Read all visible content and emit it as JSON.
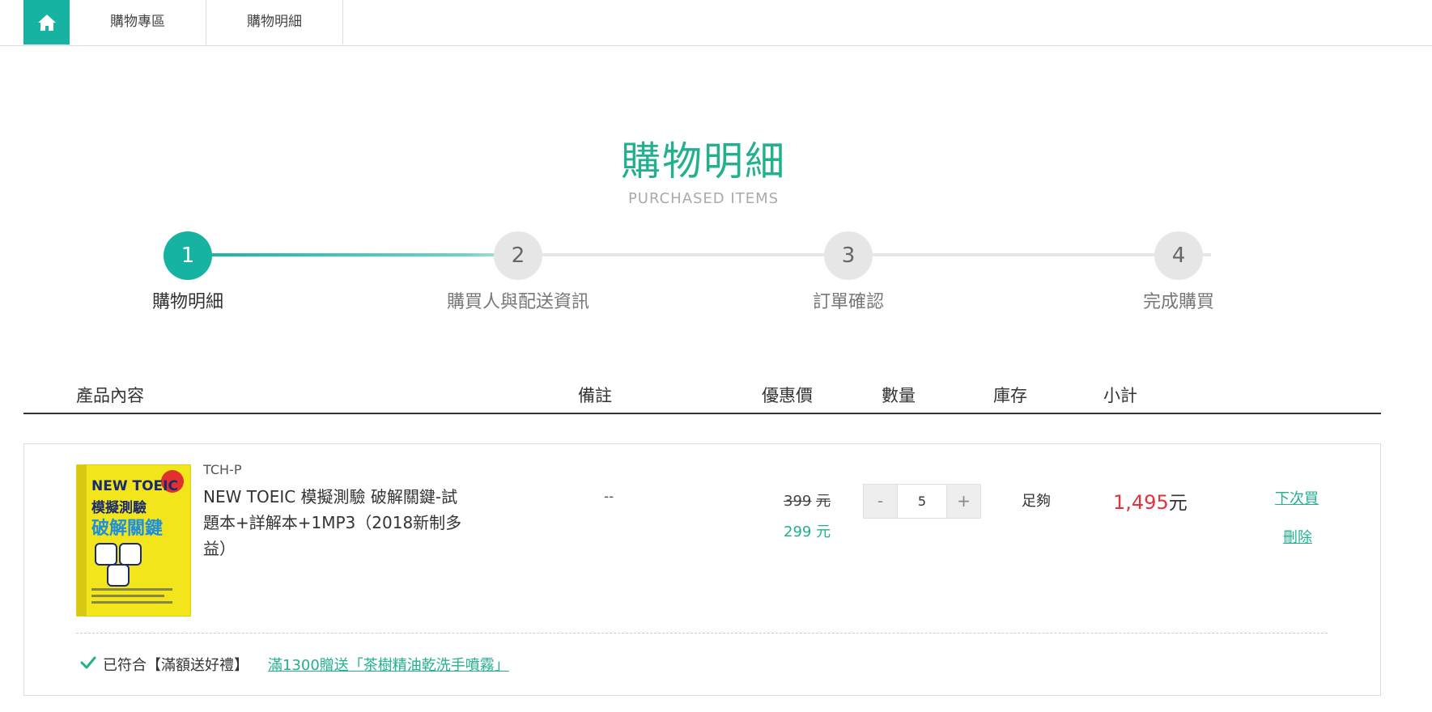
{
  "nav": {
    "home_icon": "home-icon",
    "tabs": [
      {
        "label": "購物專區"
      },
      {
        "label": "購物明細"
      }
    ]
  },
  "heading": {
    "title": "購物明細",
    "subtitle": "PURCHASED ITEMS"
  },
  "steps": [
    {
      "number": "1",
      "label": "購物明細",
      "active": true
    },
    {
      "number": "2",
      "label": "購買人與配送資訊",
      "active": false
    },
    {
      "number": "3",
      "label": "訂單確認",
      "active": false
    },
    {
      "number": "4",
      "label": "完成購買",
      "active": false
    }
  ],
  "table": {
    "columns": [
      "產品內容",
      "備註",
      "優惠價",
      "數量",
      "庫存",
      "小計"
    ]
  },
  "item": {
    "sku": "TCH-P",
    "name": "NEW TOEIC 模擬測驗 破解關鍵-試題本+詳解本+1MP3（2018新制多益）",
    "cover_text": {
      "line1": "NEW TOEIC",
      "line2": "模擬測驗",
      "line3": "破解關鍵"
    },
    "note": "--",
    "original_price": "399",
    "original_unit": "元",
    "sale_price": "299 元",
    "qty_minus": "-",
    "quantity": "5",
    "qty_plus": "+",
    "stock": "足夠",
    "subtotal": "1,495",
    "subtotal_unit": "元",
    "action_later": "下次買",
    "action_delete": "刪除"
  },
  "promo": {
    "icon": "checkmark-icon",
    "status": "已符合【滿額送好禮】",
    "link": "滿1300贈送「茶樹精油乾洗手噴霧」"
  },
  "colors": {
    "accent": "#16b3a3",
    "price_red": "#e8303a",
    "link_green": "#22b08f"
  }
}
